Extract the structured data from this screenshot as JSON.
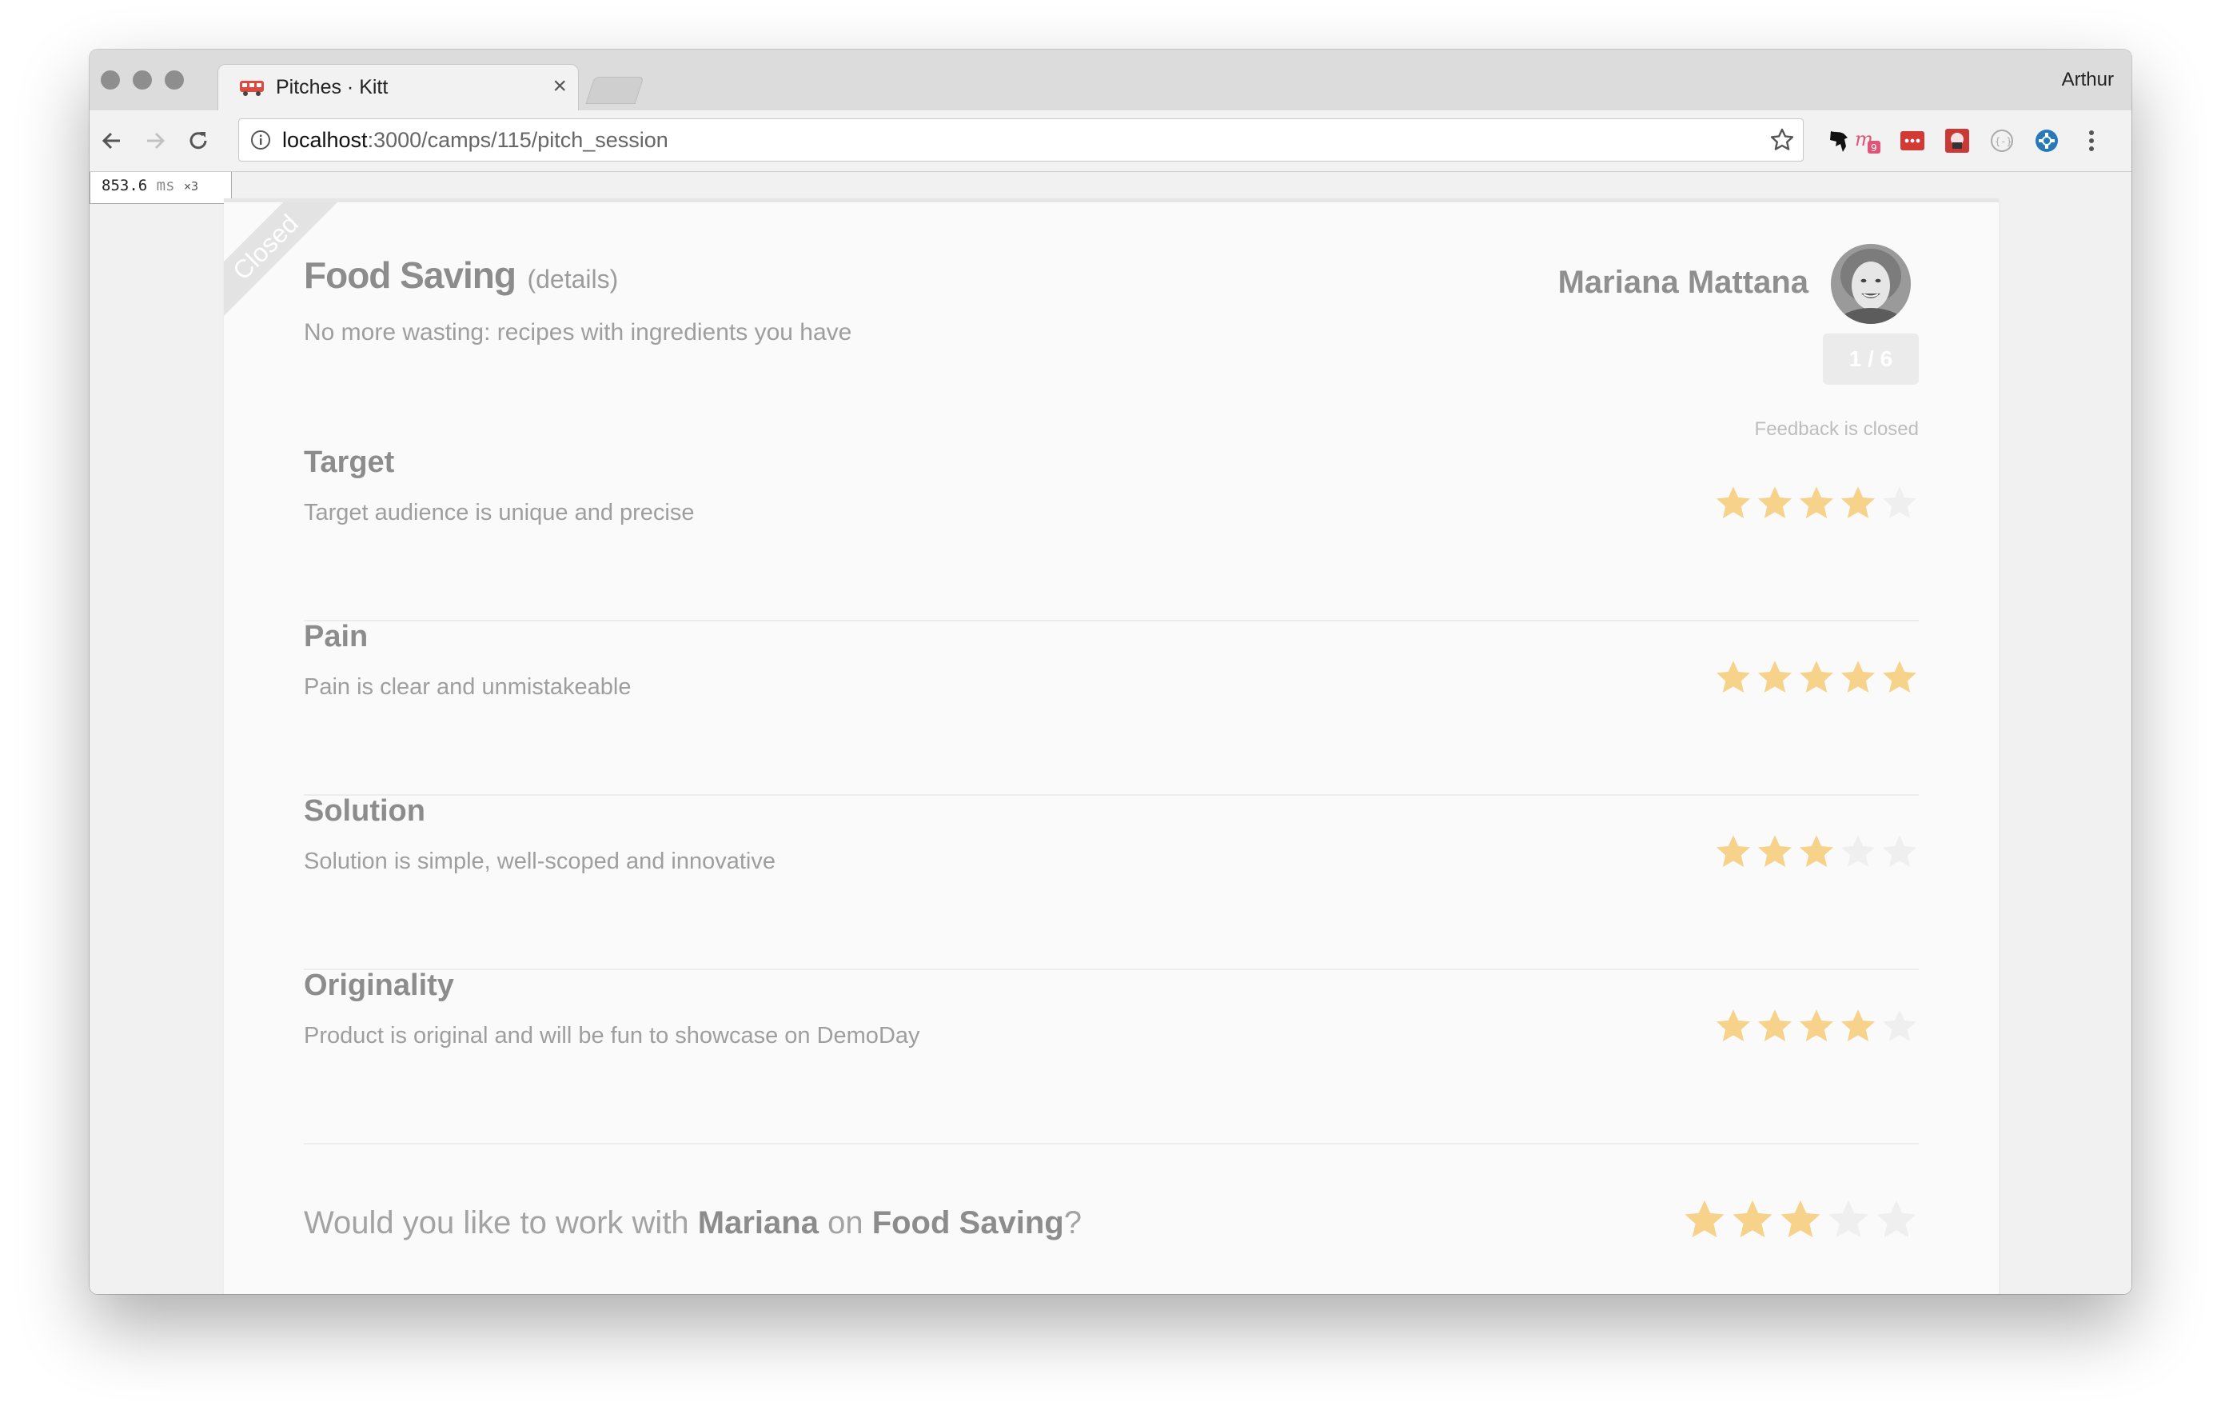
{
  "browser": {
    "tab_title": "Pitches · Kitt",
    "tab_close": "×",
    "profile_name": "Arthur",
    "url_host": "localhost",
    "url_path": ":3000/camps/115/pitch_session"
  },
  "perf": {
    "value": "853.6",
    "unit": "ms",
    "multiplier": "×3"
  },
  "pitch": {
    "status_ribbon": "Closed",
    "title": "Food Saving",
    "details_label": "(details)",
    "tagline": "No more wasting: recipes with ingredients you have",
    "founder_name": "Mariana Mattana",
    "counter": "1 / 6",
    "feedback_status": "Feedback is closed"
  },
  "criteria": [
    {
      "title": "Target",
      "description": "Target audience is unique and precise",
      "rating": 4,
      "max": 5
    },
    {
      "title": "Pain",
      "description": "Pain is clear and unmistakeable",
      "rating": 5,
      "max": 5
    },
    {
      "title": "Solution",
      "description": "Solution is simple, well-scoped and innovative",
      "rating": 3,
      "max": 5
    },
    {
      "title": "Originality",
      "description": "Product is original and will be fun to showcase on DemoDay",
      "rating": 4,
      "max": 5
    }
  ],
  "question": {
    "prefix": "Would you like to work with ",
    "name": "Mariana",
    "middle": " on ",
    "project": "Food Saving",
    "suffix": "?",
    "rating": 3,
    "max": 5
  },
  "colors": {
    "star_filled": "#f6d28b",
    "star_empty": "#efefef"
  }
}
